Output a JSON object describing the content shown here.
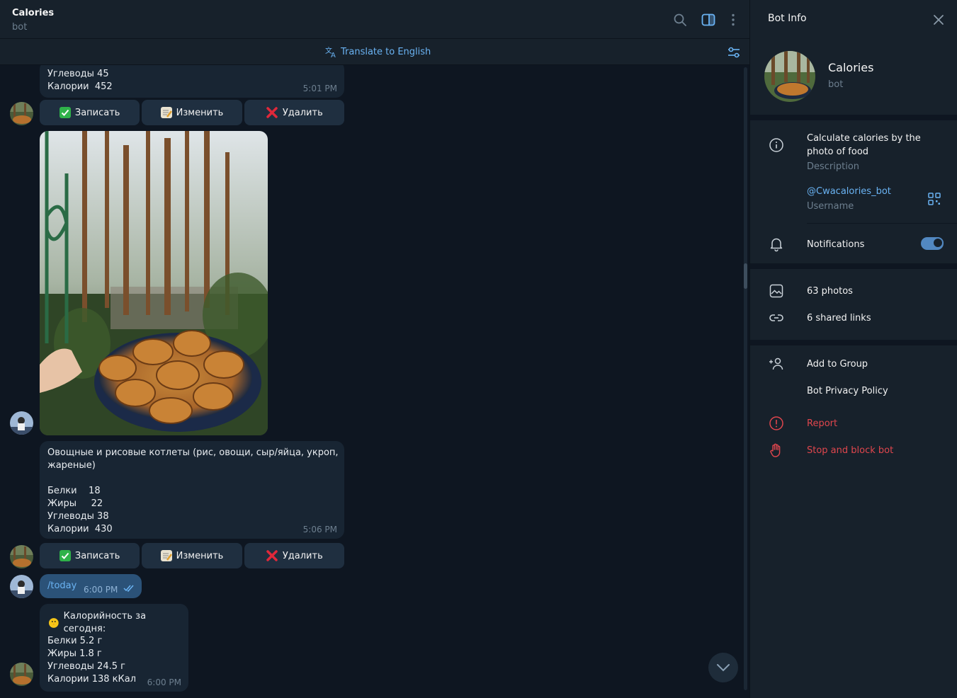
{
  "chat": {
    "title": "Calories",
    "subtitle": "bot",
    "translate_label": "Translate to English"
  },
  "messages": {
    "m1": {
      "lines": "Углеводы 45\nКалории  452",
      "time": "5:01 PM"
    },
    "keyboard": {
      "record": "Записать",
      "edit": "Изменить",
      "delete": "Удалить"
    },
    "m2": {
      "lines": "Овощные и рисовые котлеты (рис, овощи, сыр/яйца, укроп,\nжареные)\n\nБелки    18\nЖиры     22\nУглеводы 38\nКалории  430",
      "time": "5:06 PM"
    },
    "m3": {
      "command": "/today",
      "time": "6:00 PM"
    },
    "m4": {
      "title": "Калорийность за сегодня:",
      "lines": "Белки 5.2 г\nЖиры 1.8 г\nУглеводы 24.5 г\nКалории 138 кКал",
      "time": "6:00 PM"
    }
  },
  "panel": {
    "title": "Bot Info",
    "bot_name": "Calories",
    "bot_kind": "bot",
    "description": "Calculate calories by the photo of food",
    "description_label": "Description",
    "username": "@Cwacalories_bot",
    "username_label": "Username",
    "notifications_label": "Notifications",
    "notifications_on": true,
    "photos": "63 photos",
    "links": "6 shared links",
    "add_to_group": "Add to Group",
    "privacy": "Bot Privacy Policy",
    "report": "Report",
    "stop": "Stop and block bot"
  },
  "colors": {
    "accent": "#6ab3f3",
    "danger": "#e0464d",
    "bg": "#0e1621",
    "panel": "#17212b",
    "bubble": "#182533",
    "own_bubble": "#2b5278"
  }
}
